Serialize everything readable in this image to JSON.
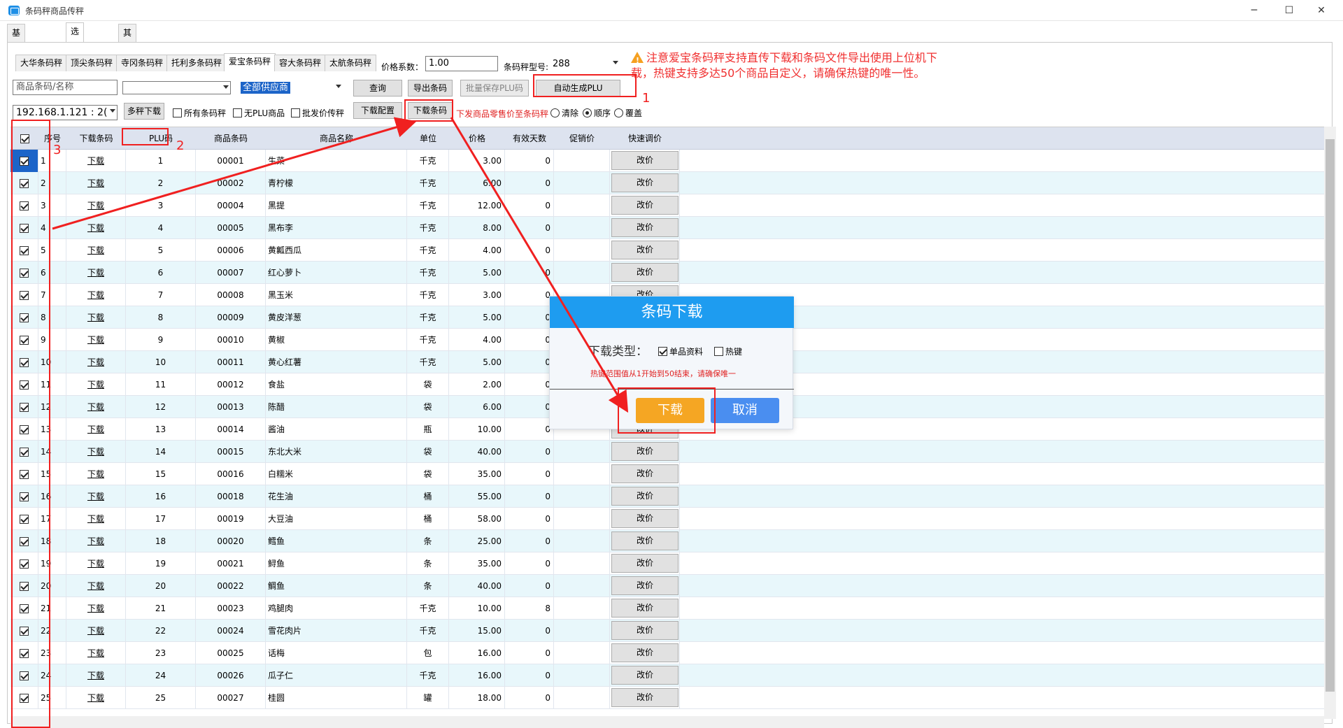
{
  "window": {
    "title": "条码秤商品传秤",
    "minimize": "─",
    "maximize": "☐",
    "close": "✕"
  },
  "tabs_top": [
    "基本参数设置",
    "选择条码秤",
    "其他参数"
  ],
  "scale_tabs": [
    "大华条码秤",
    "顶尖条码秤",
    "寺冈条码秤",
    "托利多条码秤",
    "爱宝条码秤",
    "容大条码秤",
    "太航条码秤"
  ],
  "toolbar": {
    "price_digits_label": "价格系数：",
    "price_digits_value": "1.00",
    "scale_model_label": "条码秤型号:",
    "scale_model_value": "288",
    "search_placeholder": "商品条码/名称",
    "category_value": "",
    "supplier_value": "全部供应商",
    "query": "查询",
    "export_barcode": "导出条码",
    "batch_save_plu": "批量保存PLU码",
    "auto_gen_plu": "自动生成PLU",
    "ip_value": "192.168.1.121 : 2(",
    "multi_download": "多秤下载",
    "opt_all_scales": "所有条码秤",
    "opt_no_plu": "无PLU商品",
    "opt_batch_price": "批发价传秤",
    "download_config": "下载配置",
    "download_barcode": "下载条码",
    "retail_note": "下发商品零售价至条码秤",
    "opt_clear": "清除",
    "opt_order": "顺序",
    "opt_overwrite": "覆盖"
  },
  "warning": "注意爱宝条码秤支持直传下载和条码文件导出使用上位机下载，热键支持多达50个商品自定义，请确保热键的唯一性。",
  "grid": {
    "headers": [
      "",
      "序号",
      "下载条码",
      "PLU码",
      "商品条码",
      "商品名称",
      "单位",
      "价格",
      "有效天数",
      "促销价",
      "快速调价"
    ],
    "link_label": "下载",
    "btn_label": "改价",
    "rows": [
      {
        "no": "1",
        "plu": "1",
        "code": "00001",
        "name": "生菜",
        "unit": "千克",
        "price": "3.00",
        "days": "0"
      },
      {
        "no": "2",
        "plu": "2",
        "code": "00002",
        "name": "青柠檬",
        "unit": "千克",
        "price": "6.00",
        "days": "0"
      },
      {
        "no": "3",
        "plu": "3",
        "code": "00004",
        "name": "黑提",
        "unit": "千克",
        "price": "12.00",
        "days": "0"
      },
      {
        "no": "4",
        "plu": "4",
        "code": "00005",
        "name": "黑布李",
        "unit": "千克",
        "price": "8.00",
        "days": "0"
      },
      {
        "no": "5",
        "plu": "5",
        "code": "00006",
        "name": "黄瓤西瓜",
        "unit": "千克",
        "price": "4.00",
        "days": "0"
      },
      {
        "no": "6",
        "plu": "6",
        "code": "00007",
        "name": "红心萝卜",
        "unit": "千克",
        "price": "5.00",
        "days": "0"
      },
      {
        "no": "7",
        "plu": "7",
        "code": "00008",
        "name": "黑玉米",
        "unit": "千克",
        "price": "3.00",
        "days": "0"
      },
      {
        "no": "8",
        "plu": "8",
        "code": "00009",
        "name": "黄皮洋葱",
        "unit": "千克",
        "price": "5.00",
        "days": "0"
      },
      {
        "no": "9",
        "plu": "9",
        "code": "00010",
        "name": "黄椒",
        "unit": "千克",
        "price": "4.00",
        "days": "0"
      },
      {
        "no": "10",
        "plu": "10",
        "code": "00011",
        "name": "黄心红薯",
        "unit": "千克",
        "price": "5.00",
        "days": "0"
      },
      {
        "no": "11",
        "plu": "11",
        "code": "00012",
        "name": "食盐",
        "unit": "袋",
        "price": "2.00",
        "days": "0"
      },
      {
        "no": "12",
        "plu": "12",
        "code": "00013",
        "name": "陈醋",
        "unit": "袋",
        "price": "6.00",
        "days": "0"
      },
      {
        "no": "13",
        "plu": "13",
        "code": "00014",
        "name": "酱油",
        "unit": "瓶",
        "price": "10.00",
        "days": "0"
      },
      {
        "no": "14",
        "plu": "14",
        "code": "00015",
        "name": "东北大米",
        "unit": "袋",
        "price": "40.00",
        "days": "0"
      },
      {
        "no": "15",
        "plu": "15",
        "code": "00016",
        "name": "白糯米",
        "unit": "袋",
        "price": "35.00",
        "days": "0"
      },
      {
        "no": "16",
        "plu": "16",
        "code": "00018",
        "name": "花生油",
        "unit": "桶",
        "price": "55.00",
        "days": "0"
      },
      {
        "no": "17",
        "plu": "17",
        "code": "00019",
        "name": "大豆油",
        "unit": "桶",
        "price": "58.00",
        "days": "0"
      },
      {
        "no": "18",
        "plu": "18",
        "code": "00020",
        "name": "鳕鱼",
        "unit": "条",
        "price": "25.00",
        "days": "0"
      },
      {
        "no": "19",
        "plu": "19",
        "code": "00021",
        "name": "鲟鱼",
        "unit": "条",
        "price": "35.00",
        "days": "0"
      },
      {
        "no": "20",
        "plu": "20",
        "code": "00022",
        "name": "鲷鱼",
        "unit": "条",
        "price": "40.00",
        "days": "0"
      },
      {
        "no": "21",
        "plu": "21",
        "code": "00023",
        "name": "鸡腿肉",
        "unit": "千克",
        "price": "10.00",
        "days": "8"
      },
      {
        "no": "22",
        "plu": "22",
        "code": "00024",
        "name": "雪花肉片",
        "unit": "千克",
        "price": "15.00",
        "days": "0"
      },
      {
        "no": "23",
        "plu": "23",
        "code": "00025",
        "name": "话梅",
        "unit": "包",
        "price": "16.00",
        "days": "0"
      },
      {
        "no": "24",
        "plu": "24",
        "code": "00026",
        "name": "瓜子仁",
        "unit": "千克",
        "price": "16.00",
        "days": "0"
      },
      {
        "no": "25",
        "plu": "25",
        "code": "00027",
        "name": "桂圆",
        "unit": "罐",
        "price": "18.00",
        "days": "0"
      }
    ]
  },
  "dialog": {
    "title": "条码下载",
    "type_label": "下载类型：",
    "opt_item": "单品资料",
    "opt_hotkey": "热键",
    "hint": "热键范围值从1开始到50结束，请确保唯一",
    "ok": "下载",
    "cancel": "取消"
  },
  "annotations": [
    "1",
    "2",
    "3"
  ],
  "colors": {
    "accent": "#1e9cf0",
    "ok": "#f5a623",
    "cancel": "#4a8ef0",
    "annotation": "#f02020",
    "row_alt": "#e8f7fb"
  }
}
